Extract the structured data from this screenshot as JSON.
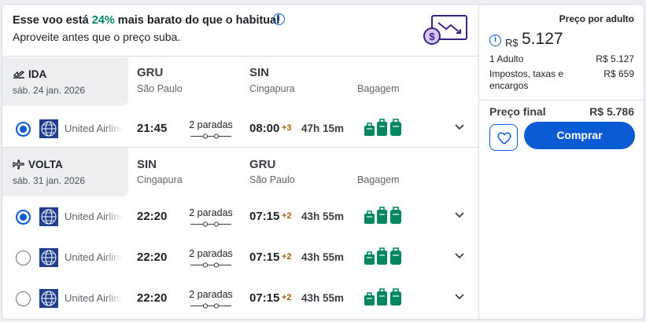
{
  "banner": {
    "title_before": "Esse voo está ",
    "title_pct": "24%",
    "title_after": " mais barato do que o habitual",
    "subtitle": "Aproveite antes que o preço suba.",
    "info_icon": "i"
  },
  "outbound": {
    "label": "IDA",
    "date": "sáb. 24 jan. 2026",
    "from_code": "GRU",
    "from_city": "São Paulo",
    "to_code": "SIN",
    "to_city": "Cingapura",
    "baggage_header": "Bagagem",
    "flights": [
      {
        "selected": true,
        "airline": "United Airlines",
        "dep": "21:45",
        "stops": "2 paradas",
        "arr": "08:00",
        "plus": "+3",
        "duration": "47h 15m"
      }
    ]
  },
  "return": {
    "label": "VOLTA",
    "date": "sáb. 31 jan. 2026",
    "from_code": "SIN",
    "from_city": "Cingapura",
    "to_code": "GRU",
    "to_city": "São Paulo",
    "baggage_header": "Bagagem",
    "flights": [
      {
        "selected": true,
        "airline": "United Airlines",
        "dep": "22:20",
        "stops": "2 paradas",
        "arr": "07:15",
        "plus": "+2",
        "duration": "43h 55m"
      },
      {
        "selected": false,
        "airline": "United Airlines",
        "dep": "22:20",
        "stops": "2 paradas",
        "arr": "07:15",
        "plus": "+2",
        "duration": "43h 55m"
      },
      {
        "selected": false,
        "airline": "United Airlines",
        "dep": "22:20",
        "stops": "2 paradas",
        "arr": "07:15",
        "plus": "+2",
        "duration": "43h 55m"
      }
    ]
  },
  "price": {
    "header": "Preço por adulto",
    "currency": "R$",
    "amount": "5.127",
    "adult_label": "1 Adulto",
    "adult_value": "R$ 5.127",
    "taxes_label_1": "Impostos, taxas e",
    "taxes_label_2": "encargos",
    "taxes_value": "R$ 659",
    "final_label": "Preço final",
    "final_value": "R$ 5.786",
    "buy_label": "Comprar"
  },
  "colors": {
    "accent": "#0a5bd4",
    "discount": "#008761",
    "baggage": "#008761",
    "plus_days": "#9b6200"
  },
  "icons": {
    "outbound": "plane-takeoff-icon",
    "return": "plane-landing-icon",
    "favorite": "heart-icon",
    "expand": "chevron-down-icon",
    "baggage": "luggage-icon"
  }
}
